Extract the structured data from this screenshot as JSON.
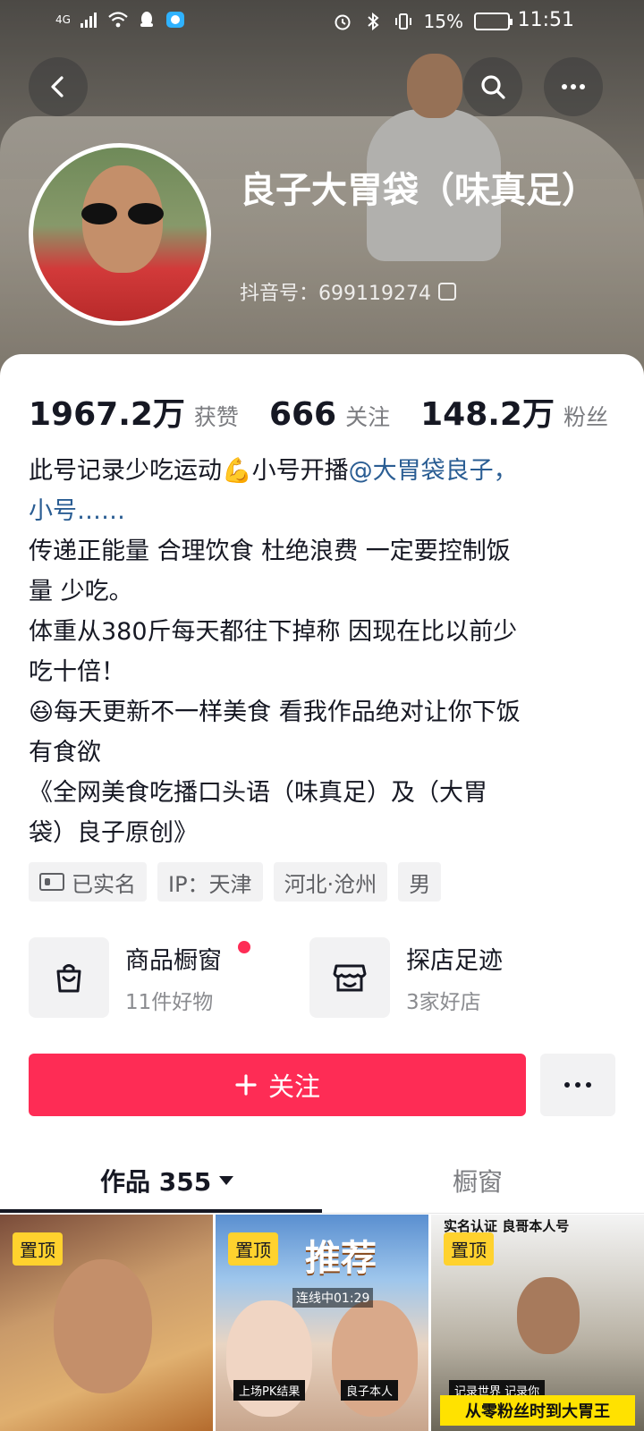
{
  "status_bar": {
    "network": "4G",
    "battery": "15%",
    "time": "11:51"
  },
  "profile": {
    "nickname": "良子大胃袋（味真足）",
    "douyin_id": "抖音号：699119274"
  },
  "stats": [
    {
      "value": "1967.2万",
      "label": "获赞"
    },
    {
      "value": "666",
      "label": "关注"
    },
    {
      "value": "148.2万",
      "label": "粉丝"
    }
  ],
  "bio": {
    "line1_text": "此号记录少吃运动💪小号开播",
    "line1_link": "@大胃袋良子，",
    "line2_link": "小号……",
    "line3": "传递正能量 合理饮食 杜绝浪费 一定要控制饭",
    "line4": "量 少吃。",
    "line5": "体重从380斤每天都往下掉称 因现在比以前少",
    "line6": "吃十倍！",
    "line7": "😆每天更新不一样美食 看我作品绝对让你下饭",
    "line8": "有食欲",
    "line9": "《全网美食吃播口头语（味真足）及（大胃",
    "line10": "袋）良子原创》"
  },
  "tags": {
    "verified": "已实名",
    "ip": "IP：天津",
    "location": "河北·沧州",
    "gender": "男"
  },
  "entries": [
    {
      "title": "商品橱窗",
      "subtitle": "11件好物",
      "icon": "shopping-bag-icon"
    },
    {
      "title": "探店足迹",
      "subtitle": "3家好店",
      "icon": "store-icon"
    }
  ],
  "follow_button": "关注",
  "tabs": {
    "works": "作品 355",
    "window": "橱窗"
  },
  "videos": [
    {
      "pin": "置顶"
    },
    {
      "pin": "置顶",
      "title": "推荐",
      "live": "连线中01:29",
      "sub_left": "上场PK结果",
      "sub_right": "良子本人"
    },
    {
      "pin": "置顶",
      "top_text": "实名认证 良哥本人号",
      "sub": "记录世界 记录你",
      "caption": "从零粉丝时到大胃王"
    }
  ],
  "colors": {
    "accent": "#fe2c55",
    "link": "#2a5d93",
    "pin_badge": "#ffd22e"
  }
}
